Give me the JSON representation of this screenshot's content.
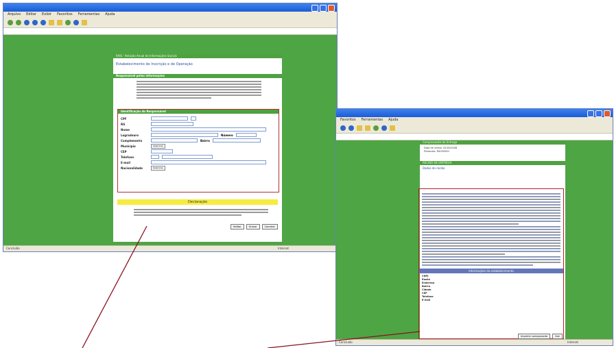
{
  "window1": {
    "menu": [
      "Arquivo",
      "Editar",
      "Exibir",
      "Favoritos",
      "Ferramentas",
      "Ajuda"
    ],
    "banner": "RAIS - Relação Anual de Informações Sociais",
    "subtitle": "Estabelecimento de Inscrição e de Operação",
    "info_header": "Responsável pelas informações",
    "form_header": "Identificação do Responsável",
    "fields": [
      "CPF",
      "RG",
      "Nome",
      "Logradouro",
      "Complemento",
      "Município",
      "CEP",
      "Telefone",
      "E-mail",
      "Nacionalidade"
    ],
    "field_extra": [
      "Número",
      "Bairro"
    ],
    "select_placeholder": "Selecione",
    "declaration_header": "Declaração",
    "buttons": [
      "Validar",
      "Gravar",
      "Cancelar"
    ],
    "status": "Concluído",
    "status_right": "Internet"
  },
  "window2": {
    "menu": [
      "Favoritos",
      "Ferramentas",
      "Ajuda"
    ],
    "banner": "Comprovante de Entrega",
    "meta_labels": [
      "Data de recibo:",
      "Protocolo:"
    ],
    "meta_values": [
      "02/05/2008",
      "RX000000"
    ],
    "result_header": "RECIBO DE ENTREGA",
    "section_label": "Dados do recibo",
    "table_header": "Informações do estabelecimento",
    "table_labels": [
      "CNPJ",
      "Razão",
      "Endereço",
      "Bairro",
      "Cidade",
      "CEP",
      "Telefone",
      "E-mail"
    ],
    "buttons": [
      "Imprimir comprovante",
      "Sair"
    ],
    "status": "Concluído",
    "status_right": "Internet"
  }
}
